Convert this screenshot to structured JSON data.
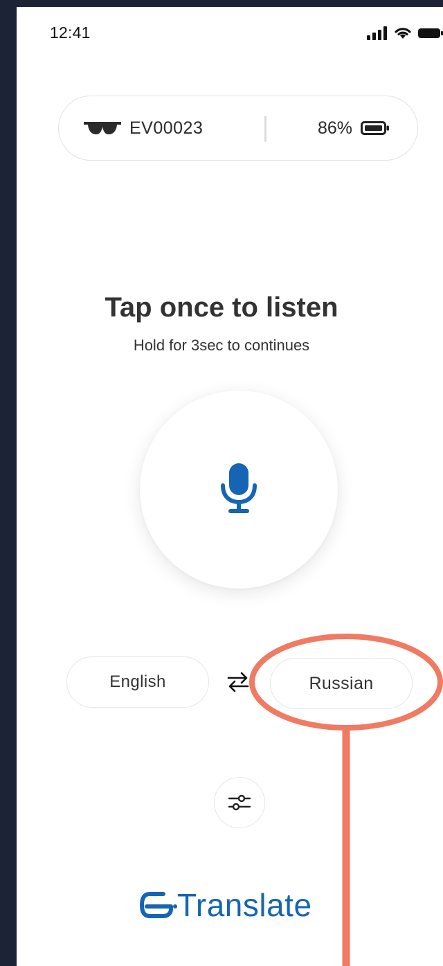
{
  "status_bar": {
    "time": "12:41"
  },
  "device": {
    "name": "EV00023",
    "battery": "86%"
  },
  "prompt": {
    "title": "Tap once to listen",
    "subtitle": "Hold for 3sec to continues"
  },
  "languages": {
    "source": "English",
    "target": "Russian"
  },
  "brand": {
    "suffix": "Translate"
  },
  "icons": {
    "glasses": "sunglasses-icon",
    "battery": "battery-icon",
    "mic": "microphone-icon",
    "swap": "swap-arrows-icon",
    "settings": "sliders-icon"
  },
  "colors": {
    "accent": "#1565b4",
    "annotation": "#f07a62",
    "background_outer": "#1d2337"
  }
}
